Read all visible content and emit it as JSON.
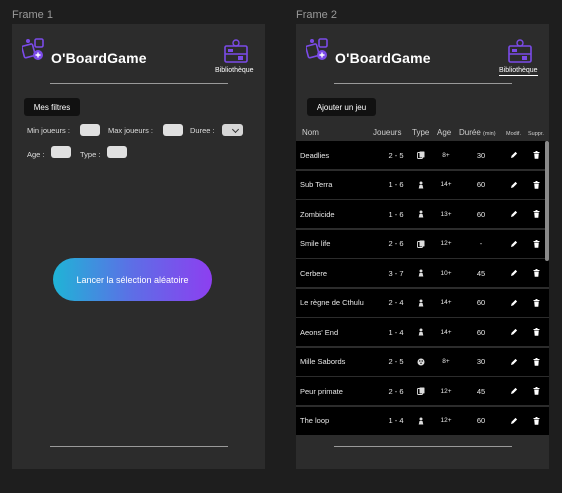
{
  "frame1": {
    "label": "Frame 1",
    "app_title": "O'BoardGame",
    "library_label": "Bibliothèque",
    "filters_button": "Mes filtres",
    "filters": {
      "min_players_label": "Min joueurs :",
      "max_players_label": "Max joueurs :",
      "duration_label": "Duree :",
      "age_label": "Age :",
      "type_label": "Type :"
    },
    "random_button": "Lancer la sélection aléatoire"
  },
  "frame2": {
    "label": "Frame 2",
    "app_title": "O'BoardGame",
    "library_label": "Bibliothèque",
    "add_button": "Ajouter un jeu",
    "columns": {
      "name": "Nom",
      "players": "Joueurs",
      "type": "Type",
      "age": "Age",
      "duration": "Durée",
      "duration_unit": "(min)",
      "edit": "Modif.",
      "delete": "Suppr."
    },
    "games": [
      {
        "name": "Deadlies",
        "players": "2 - 5",
        "type_icon": "cards-icon",
        "age": "8+",
        "duration": "30"
      },
      {
        "name": "Sub Terra",
        "players": "1 - 6",
        "type_icon": "pawn-icon",
        "age": "14+",
        "duration": "60"
      },
      {
        "name": "Zombicide",
        "players": "1 - 6",
        "type_icon": "pawn-icon",
        "age": "13+",
        "duration": "60"
      },
      {
        "name": "Smile life",
        "players": "2 - 6",
        "type_icon": "cards-icon",
        "age": "12+",
        "duration": "-"
      },
      {
        "name": "Cerbere",
        "players": "3 - 7",
        "type_icon": "pawn-icon",
        "age": "10+",
        "duration": "45"
      },
      {
        "name": "Le règne de Cthulu",
        "players": "2 - 4",
        "type_icon": "pawn-icon",
        "age": "14+",
        "duration": "60"
      },
      {
        "name": "Aeons' End",
        "players": "1 - 4",
        "type_icon": "pawn-icon",
        "age": "14+",
        "duration": "60"
      },
      {
        "name": "Mille Sabords",
        "players": "2 - 5",
        "type_icon": "dice-icon",
        "age": "8+",
        "duration": "30"
      },
      {
        "name": "Peur primate",
        "players": "2 - 6",
        "type_icon": "cards-icon",
        "age": "12+",
        "duration": "45"
      },
      {
        "name": "The loop",
        "players": "1 - 4",
        "type_icon": "pawn-icon",
        "age": "12+",
        "duration": "60"
      }
    ]
  },
  "colors": {
    "background": "#1e1e1e",
    "frame": "#2c2c2c",
    "accent_purple": "#7b4be8",
    "gradient_start": "#1fb4d6",
    "gradient_end": "#8d3ff0"
  }
}
